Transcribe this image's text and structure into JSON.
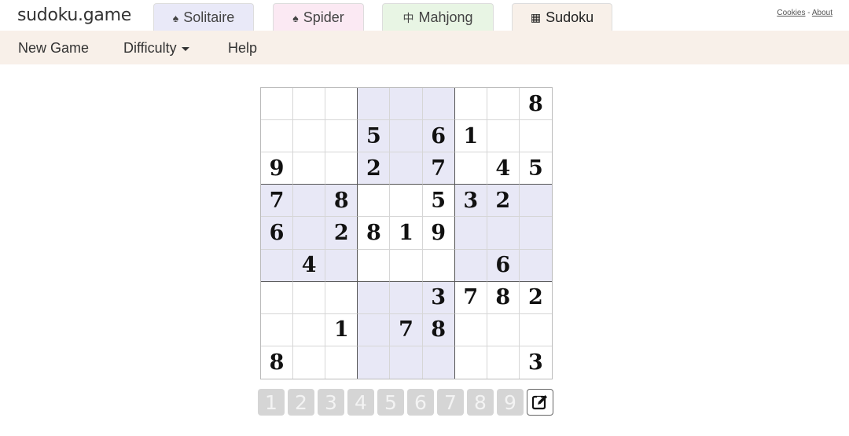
{
  "header": {
    "brand": "sudoku.game",
    "tabs": [
      {
        "label": "Solitaire",
        "icon": "spade-icon",
        "glyph": "♠"
      },
      {
        "label": "Spider",
        "icon": "spade-icon",
        "glyph": "♠"
      },
      {
        "label": "Mahjong",
        "icon": "mahjong-tile-icon",
        "glyph": "中"
      },
      {
        "label": "Sudoku",
        "icon": "grid-icon",
        "glyph": "▦"
      }
    ],
    "links": {
      "cookies": "Cookies",
      "separator": "-",
      "about": "About"
    }
  },
  "menu": {
    "new_game": "New Game",
    "difficulty": "Difficulty",
    "help": "Help"
  },
  "board": {
    "grid": [
      [
        "",
        "",
        "",
        "",
        "",
        "",
        "",
        "",
        "8"
      ],
      [
        "",
        "",
        "",
        "5",
        "",
        "6",
        "1",
        "",
        ""
      ],
      [
        "9",
        "",
        "",
        "2",
        "",
        "7",
        "",
        "4",
        "5"
      ],
      [
        "7",
        "",
        "8",
        "",
        "",
        "5",
        "3",
        "2",
        ""
      ],
      [
        "6",
        "",
        "2",
        "8",
        "1",
        "9",
        "",
        "",
        ""
      ],
      [
        "",
        "4",
        "",
        "",
        "",
        "",
        "",
        "6",
        ""
      ],
      [
        "",
        "",
        "",
        "",
        "",
        "3",
        "7",
        "8",
        "2"
      ],
      [
        "",
        "",
        "1",
        "",
        "7",
        "8",
        "",
        "",
        ""
      ],
      [
        "8",
        "",
        "",
        "",
        "",
        "",
        "",
        "",
        "3"
      ]
    ],
    "shaded_box_color": "#e8e8f6"
  },
  "number_pad": {
    "keys": [
      "1",
      "2",
      "3",
      "4",
      "5",
      "6",
      "7",
      "8",
      "9"
    ],
    "notes_icon": "pencil-edit-icon"
  }
}
